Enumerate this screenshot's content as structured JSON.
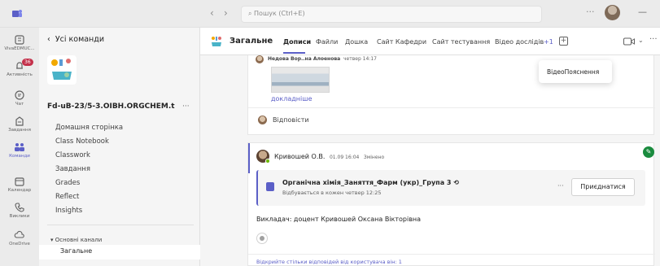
{
  "topbar": {
    "search_placeholder": "Пошук (Ctrl+E)",
    "back_arrow": "‹",
    "forward_arrow": "›",
    "more": "···"
  },
  "rail": {
    "items": [
      {
        "label": "VivaEDMUC...",
        "icon": "book-icon"
      },
      {
        "label": "Активність",
        "icon": "bell-icon",
        "badge": "36"
      },
      {
        "label": "Чат",
        "icon": "chat-icon"
      },
      {
        "label": "Завдання",
        "icon": "assignments-icon"
      },
      {
        "label": "Команди",
        "icon": "teams-icon"
      },
      {
        "label": "Календар",
        "icon": "calendar-icon"
      },
      {
        "label": "Виклики",
        "icon": "phone-icon"
      },
      {
        "label": "OneDrive",
        "icon": "cloud-icon"
      }
    ]
  },
  "panel": {
    "back_label": "Усі команди",
    "team_name": "Fd-uB-23/5-3.OIBH.ORGCHEM.t",
    "team_more": "···",
    "links": [
      "Домашня сторінка",
      "Class Notebook",
      "Classwork",
      "Завдання",
      "Grades",
      "Reflect",
      "Insights"
    ],
    "section_label": "Основні канали",
    "active_channel": "Загальне"
  },
  "header": {
    "channel_name": "Загальне",
    "tabs": [
      "Дописи",
      "Файли",
      "Дошка",
      "Сайт Кафедри",
      "Сайт тестування",
      "Відео дослідів"
    ],
    "tabs_more": "+1",
    "add_tab": "+"
  },
  "post1": {
    "author": "Недова Вор..на Алоенова",
    "time": "четвер 14:17",
    "more_link": "докладніше",
    "reply_label": "Відповісти"
  },
  "popup": {
    "item": "ВідеоПояснення"
  },
  "post2": {
    "author": "Кривошей О.В.",
    "date": "01.09 16:04",
    "edited": "Змінено",
    "meeting_title": "Органічна хімія_Заняття_Фарм (укр)_Група 3",
    "meeting_sub": "Відбувається в кожен четвер 12:25",
    "meeting_more": "···",
    "join_label": "Приєднатися",
    "text": "Викладач: доцент Кривошей Оксана Вікторівна",
    "open_replies": "Відкрийте стільки відповідей від користувача він: 1"
  },
  "colors": {
    "accent": "#5b5fc7",
    "badge": "#c4314b",
    "presence": "#6bb700"
  }
}
